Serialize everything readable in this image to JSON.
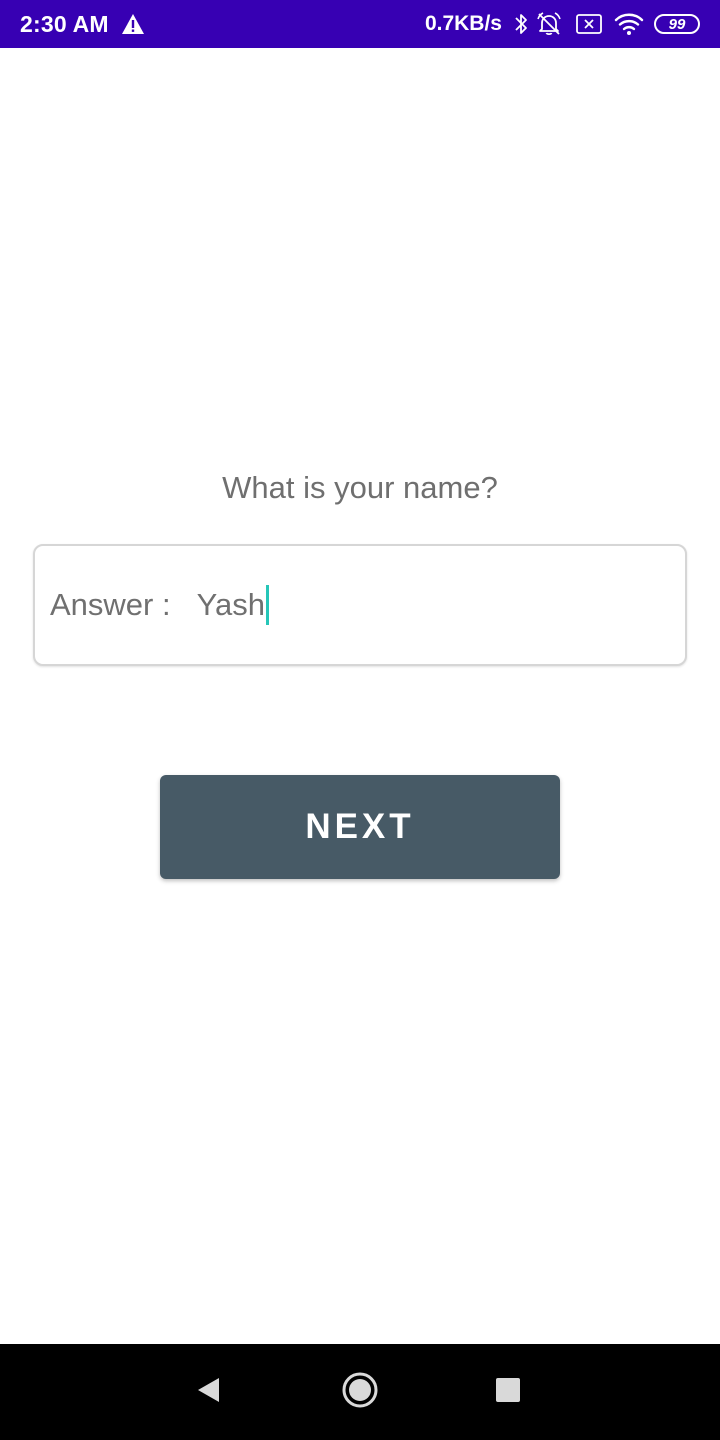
{
  "status_bar": {
    "time": "2:30 AM",
    "network_speed": "0.7KB/s",
    "battery_level": "99",
    "background_color": "#3700b3",
    "icons": [
      "alert-icon",
      "bluetooth-icon",
      "notifications-off-icon",
      "sim-error-icon",
      "wifi-icon",
      "battery-icon"
    ]
  },
  "question": {
    "text": "What is your name?"
  },
  "answer": {
    "label": "Answer :",
    "value": "Yash",
    "caret_color": "#26c6b8"
  },
  "next_button": {
    "label": "NEXT",
    "color": "#475a66"
  },
  "nav_bar": {
    "icons": [
      "back-icon",
      "home-icon",
      "recents-icon"
    ]
  }
}
